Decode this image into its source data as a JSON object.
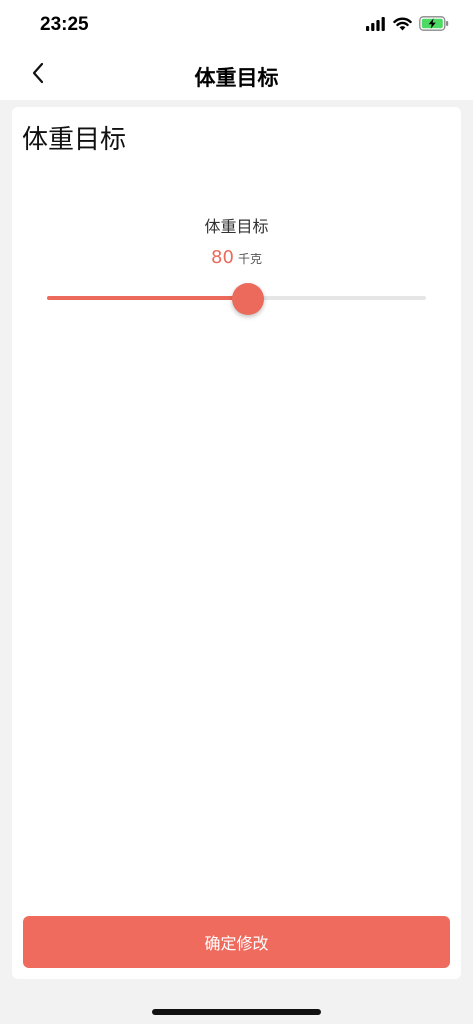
{
  "status_bar": {
    "time": "23:25",
    "icons": [
      "signal-icon",
      "wifi-icon",
      "battery-charging-icon"
    ]
  },
  "nav": {
    "title": "体重目标",
    "back_icon": "chevron-left-icon"
  },
  "card": {
    "title": "体重目标",
    "slider": {
      "label": "体重目标",
      "value": "80",
      "unit": "千克",
      "fill_fraction": 0.53
    }
  },
  "confirm_button": {
    "label": "确定修改"
  },
  "colors": {
    "accent": "#ec6a5c",
    "background": "#f2f2f2",
    "track": "#e6e6e6",
    "battery": "#4cd964"
  }
}
